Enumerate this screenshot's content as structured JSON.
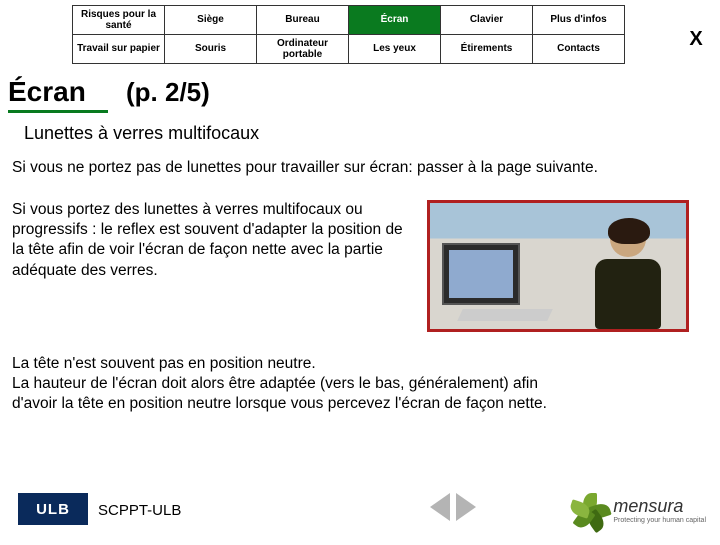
{
  "nav": {
    "row1": [
      "Risques pour la santé",
      "Siège",
      "Bureau",
      "Écran",
      "Clavier",
      "Plus d'infos"
    ],
    "row2": [
      "Travail sur papier",
      "Souris",
      "Ordinateur portable",
      "Les yeux",
      "Étirements",
      "Contacts"
    ],
    "active": "Écran"
  },
  "close_label": "X",
  "title": {
    "section": "Écran",
    "page": "(p. 2/5)"
  },
  "subtitle": "Lunettes à verres multifocaux",
  "para1": "Si vous ne portez pas de lunettes pour travailler sur écran: passer à la page suivante.",
  "para2": "Si vous portez des lunettes à verres multifocaux ou progressifs : le reflex est souvent d'adapter la position de la tête afin de voir l'écran de façon nette avec la partie adéquate des verres.",
  "para3": "La tête n'est souvent pas en position neutre.\nLa hauteur de l'écran doit alors être adaptée (vers le bas, généralement) afin d'avoir la tête en position neutre lorsque vous percevez l'écran de façon nette.",
  "footer": {
    "ulb": "ULB",
    "scppt": "SCPPT-ULB",
    "mensura": "mensura",
    "mensura_tag": "Protecting your human capital"
  }
}
